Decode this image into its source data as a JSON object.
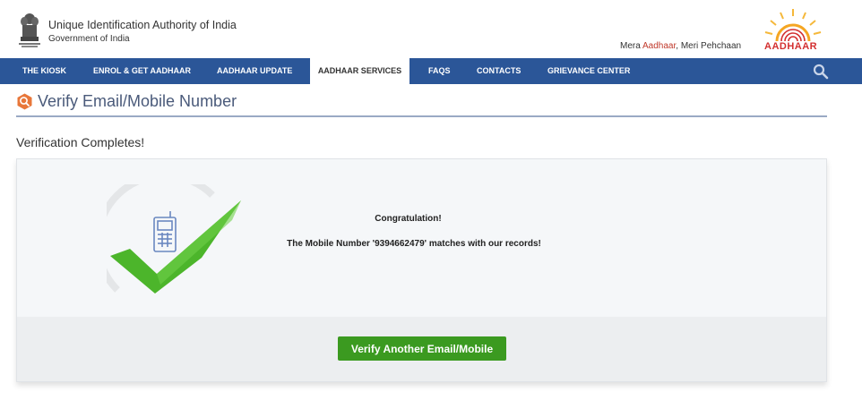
{
  "header": {
    "org_name": "Unique Identification Authority of India",
    "org_sub": "Government of India",
    "tagline_prefix": "Mera ",
    "tagline_highlight": "Aadhaar",
    "tagline_suffix": ", Meri Pehchaan",
    "logo_text": "AADHAAR"
  },
  "nav": {
    "items": [
      {
        "label": "THE KIOSK"
      },
      {
        "label": "ENROL & GET AADHAAR"
      },
      {
        "label": "AADHAAR UPDATE"
      },
      {
        "label": "AADHAAR SERVICES",
        "active": true
      },
      {
        "label": "FAQS"
      },
      {
        "label": "CONTACTS"
      },
      {
        "label": "GRIEVANCE CENTER"
      }
    ]
  },
  "page": {
    "title": "Verify Email/Mobile Number",
    "subtitle": "Verification Completes!",
    "message_title": "Congratulation!",
    "message_body": "The Mobile Number '9394662479' matches with our records!",
    "button_label": "Verify Another Email/Mobile"
  },
  "colors": {
    "nav_bg": "#2b5698",
    "button_bg": "#3b9a20",
    "tagline_highlight": "#c0392b",
    "check_green": "#4cb52b"
  },
  "icons": [
    "national-emblem-icon",
    "aadhaar-logo-icon",
    "search-icon",
    "search-magnifier-badge-icon",
    "mobile-phone-icon",
    "checkmark-icon"
  ]
}
